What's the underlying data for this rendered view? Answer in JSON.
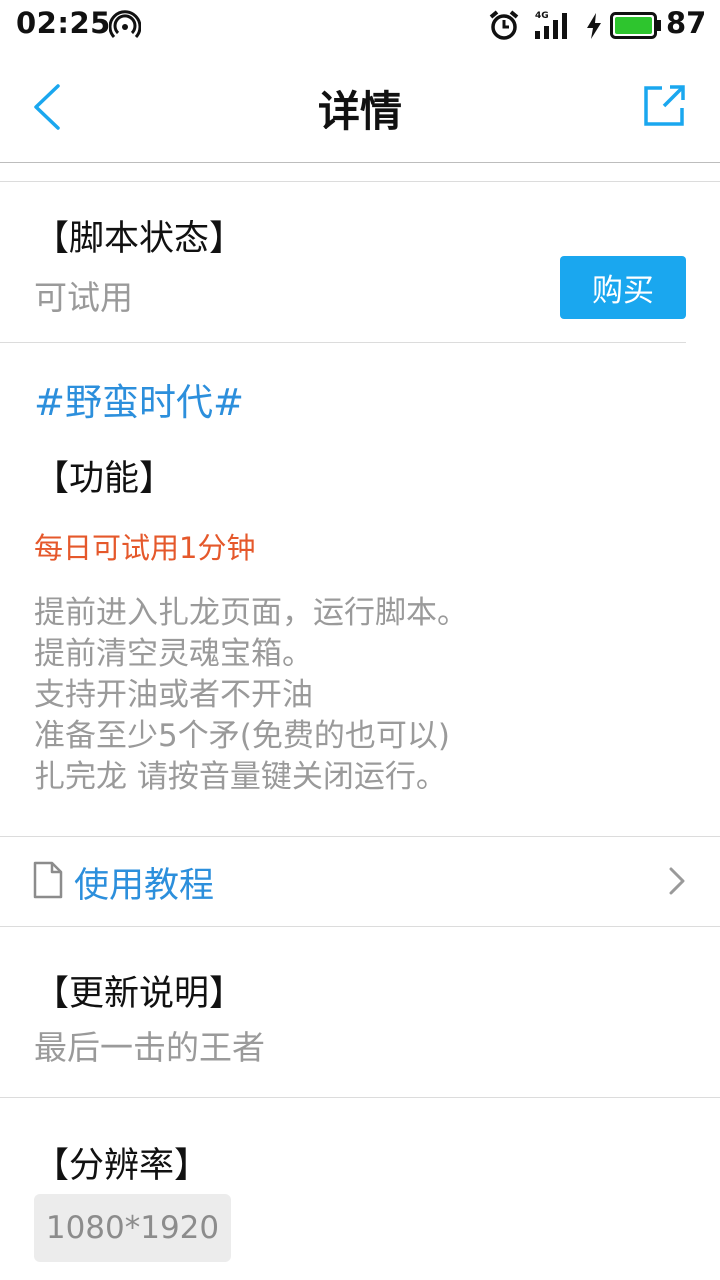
{
  "status_bar": {
    "time": "02:25",
    "signal_label": "4G",
    "battery_level": "87"
  },
  "nav": {
    "title": "详情"
  },
  "script_status": {
    "heading": "【脚本状态】",
    "value": "可试用",
    "buy_label": "购买"
  },
  "topic": "#野蛮时代#",
  "features": {
    "heading": "【功能】",
    "notice": "每日可试用1分钟",
    "lines": [
      "提前进入扎龙页面，运行脚本。",
      "提前清空灵魂宝箱。",
      "支持开油或者不开油",
      "准备至少5个矛(免费的也可以)",
      "扎完龙 请按音量键关闭运行。"
    ]
  },
  "tutorial": {
    "label": "使用教程"
  },
  "update": {
    "heading": "【更新说明】",
    "text": "最后一击的王者"
  },
  "resolution": {
    "heading": "【分辨率】",
    "value": "1080*1920"
  },
  "colors": {
    "accent": "#1aa7ef",
    "link": "#2c8fdc",
    "notice": "#e5582b",
    "battery": "#2ec52e"
  }
}
